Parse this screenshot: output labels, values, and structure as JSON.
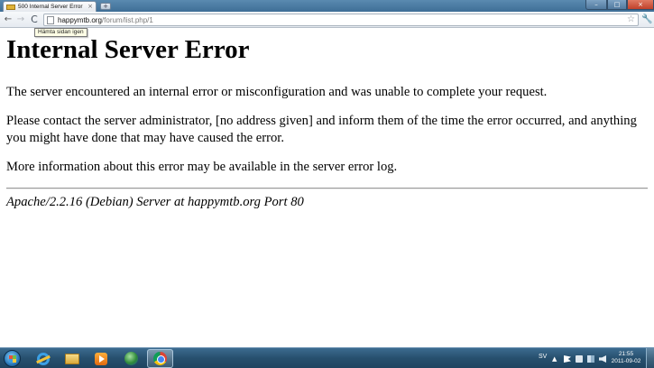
{
  "browser": {
    "tab": {
      "title": "500 Internal Server Error",
      "close_glyph": "×",
      "favicon": "page-favicon-icon"
    },
    "new_tab_glyph": "+",
    "window_controls": {
      "minimize": "–",
      "maximize": "□",
      "close": "×"
    },
    "nav": {
      "back": "←",
      "forward": "→",
      "reload": "C"
    },
    "address_bar": {
      "host": "happymtb.org",
      "path": "/forum/list.php/1"
    },
    "bookmark_star": "☆",
    "wrench_glyph": "🔧",
    "tooltip": "Hämta sidan igen"
  },
  "page": {
    "heading": "Internal Server Error",
    "paragraph1": "The server encountered an internal error or misconfiguration and was unable to complete your request.",
    "paragraph2": "Please contact the server administrator, [no address given] and inform them of the time the error occurred, and anything you might have done that may have caused the error.",
    "paragraph3": "More information about this error may be available in the server error log.",
    "server_signature": "Apache/2.2.16 (Debian) Server at happymtb.org Port 80"
  },
  "taskbar": {
    "pinned": [
      {
        "name": "internet-explorer-icon"
      },
      {
        "name": "windows-explorer-folder-icon"
      },
      {
        "name": "media-player-icon"
      },
      {
        "name": "globe-app-icon"
      },
      {
        "name": "chrome-icon",
        "active": true
      }
    ],
    "tray": {
      "language": "SV",
      "show_hidden_glyph": "▲",
      "time": "21:55",
      "date": "2011-09-02"
    }
  },
  "colors": {
    "taskbar": "#27506e",
    "titlebar": "#4a7aa2",
    "tooltip_bg": "#ffffe6",
    "rule": "#9a9a9a"
  }
}
